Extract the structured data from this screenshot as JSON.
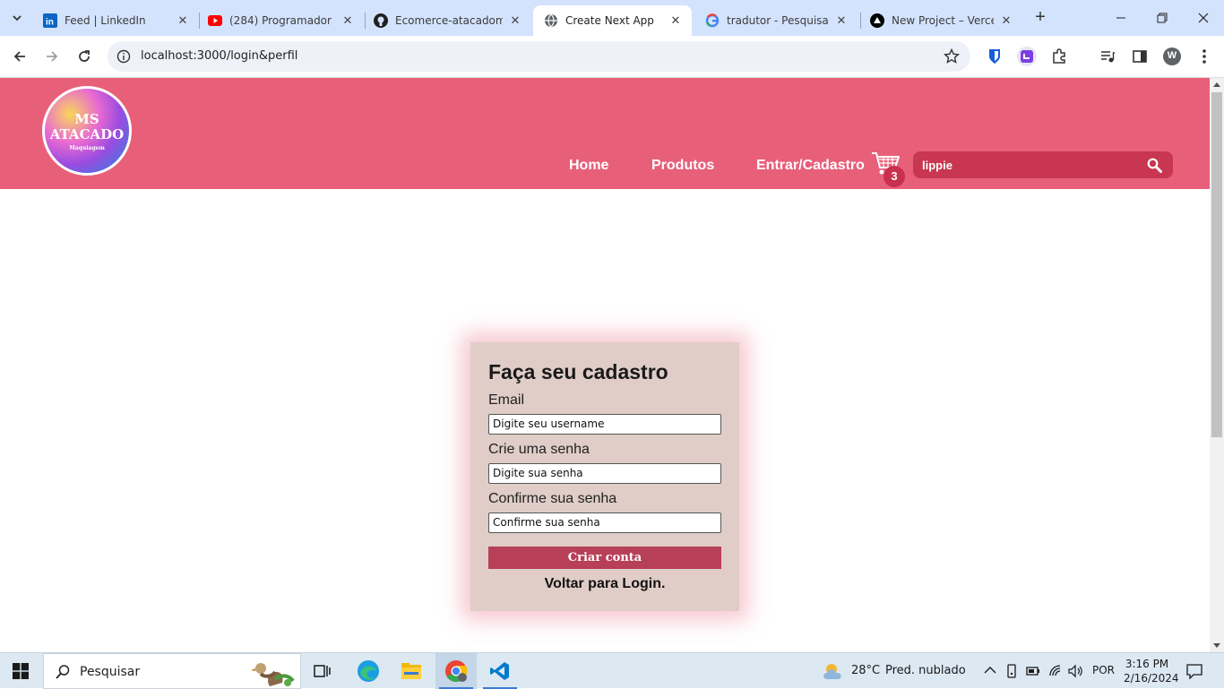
{
  "browser": {
    "tabs": [
      {
        "title": "Feed | LinkedIn",
        "icon": "linkedin-icon"
      },
      {
        "title": "(284) Programador De",
        "icon": "youtube-icon"
      },
      {
        "title": "Ecomerce-atacadoms",
        "icon": "github-icon"
      },
      {
        "title": "Create Next App",
        "icon": "globe-icon",
        "active": true
      },
      {
        "title": "tradutor - Pesquisa G",
        "icon": "google-icon"
      },
      {
        "title": "New Project – Vercel",
        "icon": "vercel-icon"
      }
    ],
    "url": "localhost:3000/login&perfil",
    "profile_initial": "W"
  },
  "site": {
    "logo": {
      "line1": "MS",
      "line2": "ATACADO",
      "line3": "Maquiagem"
    },
    "nav": {
      "home": "Home",
      "products": "Produtos",
      "login": "Entrar/Cadastro"
    },
    "cart_count": "3",
    "search_value": "lippie"
  },
  "signup": {
    "title": "Faça seu cadastro",
    "email_label": "Email",
    "email_placeholder": "Digite seu username",
    "password_label": "Crie uma senha",
    "password_placeholder": "Digite sua senha",
    "confirm_label": "Confirme sua senha",
    "confirm_placeholder": "Confirme sua senha",
    "submit_label": "Criar conta",
    "back_label": "Voltar para Login."
  },
  "taskbar": {
    "search_placeholder": "Pesquisar",
    "weather": "28°C",
    "weather_desc": "Pred. nublado",
    "language": "POR",
    "time": "3:16 PM",
    "date": "2/16/2024"
  },
  "colors": {
    "header": "#e85f7a",
    "button": "#b83f58",
    "card": "#e0cdc7"
  }
}
